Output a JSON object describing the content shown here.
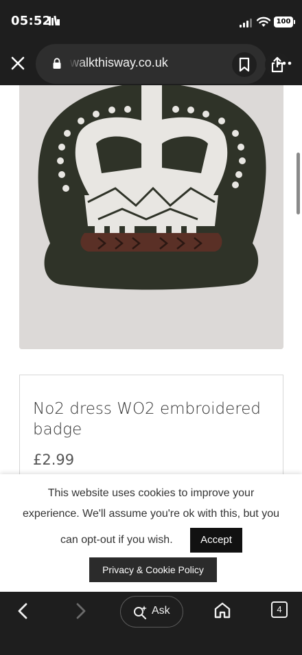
{
  "status_bar": {
    "time": "05:52",
    "battery": "100",
    "app_icon": "reading-library-icon",
    "signal_icon": "cellular-signal-icon",
    "wifi_icon": "wifi-icon"
  },
  "browser": {
    "url": "walkthisway.co.uk",
    "icons": {
      "close": "close-icon",
      "lock": "lock-icon",
      "bookmark": "bookmark-icon",
      "share": "share-icon",
      "more": "more-horizontal-icon"
    }
  },
  "product": {
    "title": "No2 dress WO2 embroidered badge",
    "price": "£2.99",
    "image": "embroidered-crown-badge"
  },
  "cookie_banner": {
    "line1": "This website uses cookies to improve your",
    "line2": "experience. We'll assume you're ok with this, but you",
    "line3": "can opt-out if you wish.",
    "accept_label": "Accept",
    "policy_label": "Privacy & Cookie Policy"
  },
  "bottom_nav": {
    "ask_label": "Ask",
    "tab_count": "4",
    "icons": {
      "back": "chevron-left-icon",
      "forward": "chevron-right-icon",
      "ask": "sparkle-search-icon",
      "home": "home-icon"
    }
  },
  "colors": {
    "chrome_bg": "#1e1e1e",
    "url_pill": "#2e2e2e",
    "button_dark": "#111111",
    "badge_green": "#2f3328",
    "badge_white": "#e8e6e2",
    "badge_brown": "#5a3026"
  }
}
